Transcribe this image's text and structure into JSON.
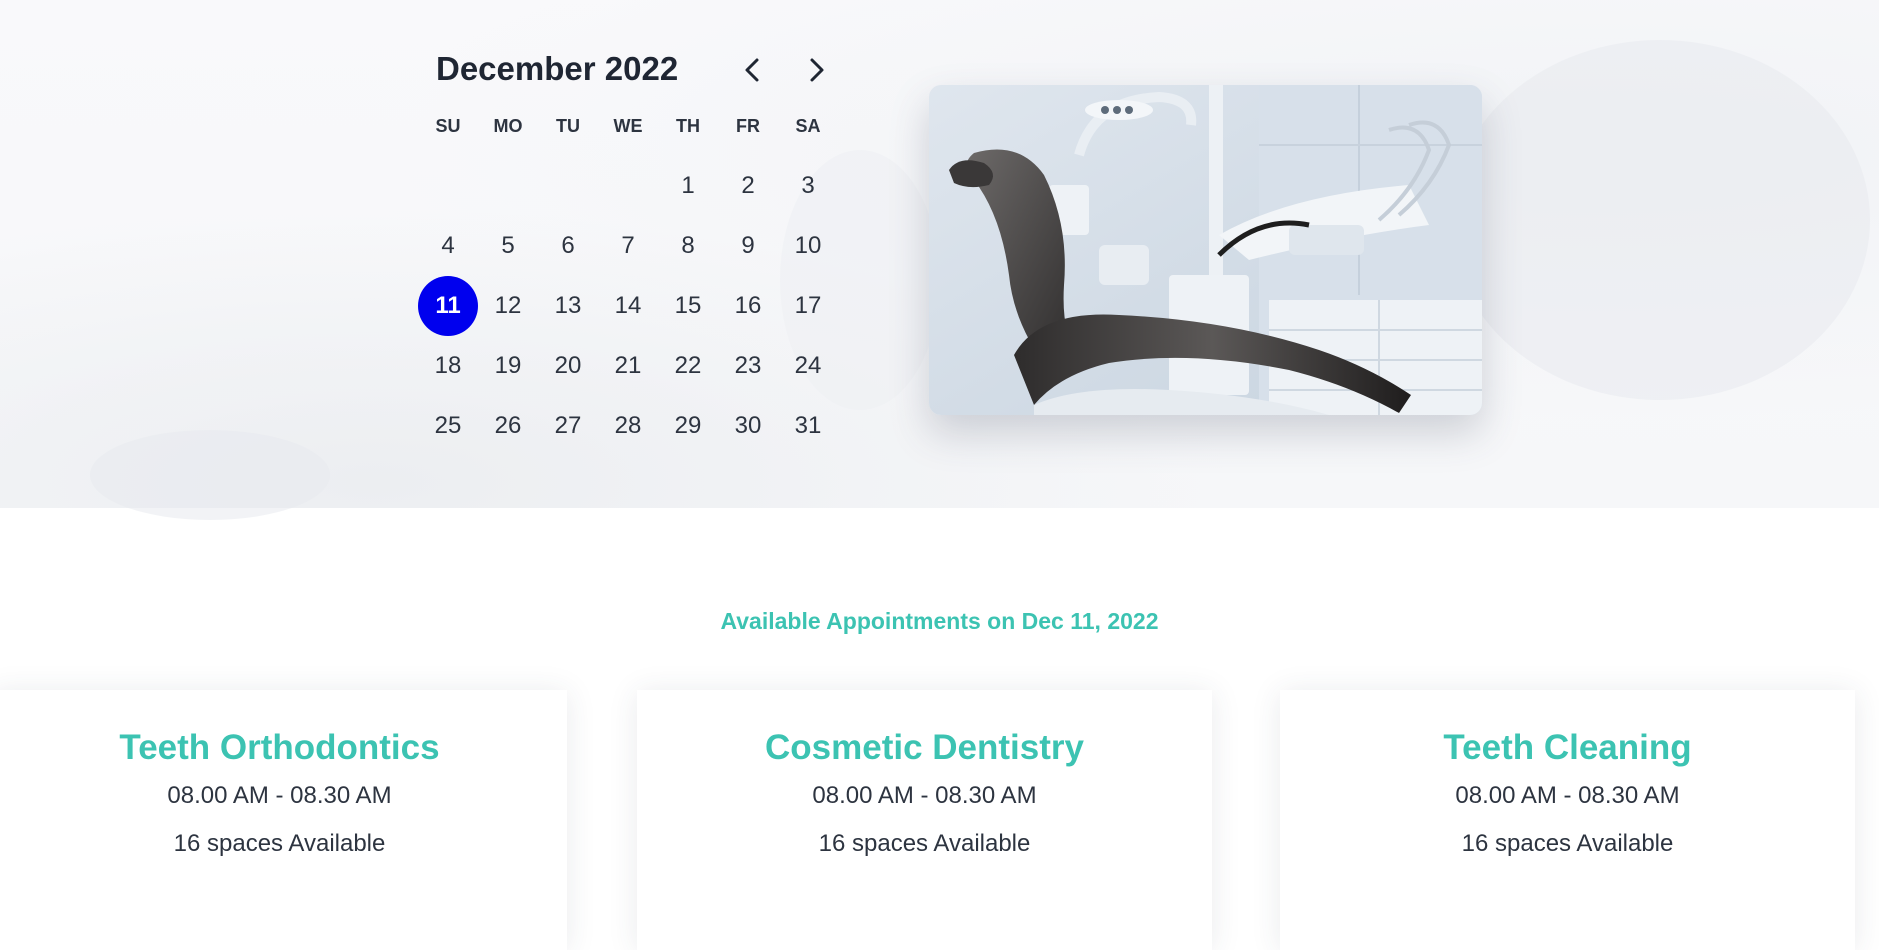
{
  "calendar": {
    "month_title": "December 2022",
    "prev_icon": "chevron-left-icon",
    "next_icon": "chevron-right-icon",
    "weekdays": [
      "SU",
      "MO",
      "TU",
      "WE",
      "TH",
      "FR",
      "SA"
    ],
    "weeks": [
      [
        "",
        "",
        "",
        "",
        "1",
        "2",
        "3"
      ],
      [
        "4",
        "5",
        "6",
        "7",
        "8",
        "9",
        "10"
      ],
      [
        "11",
        "12",
        "13",
        "14",
        "15",
        "16",
        "17"
      ],
      [
        "18",
        "19",
        "20",
        "21",
        "22",
        "23",
        "24"
      ],
      [
        "25",
        "26",
        "27",
        "28",
        "29",
        "30",
        "31"
      ]
    ],
    "selected_day": "11",
    "selected_color": "#0000ee"
  },
  "hero_image": {
    "icon": "dental-chair-photo"
  },
  "appointments": {
    "title": "Available Appointments on Dec 11, 2022",
    "accent_color": "#3cc3b2",
    "cards": [
      {
        "title": "Teeth Orthodontics",
        "time": "08.00 AM - 08.30 AM",
        "spaces": "16 spaces Available"
      },
      {
        "title": "Cosmetic Dentistry",
        "time": "08.00 AM - 08.30 AM",
        "spaces": "16 spaces Available"
      },
      {
        "title": "Teeth Cleaning",
        "time": "08.00 AM - 08.30 AM",
        "spaces": "16 spaces Available"
      }
    ]
  }
}
